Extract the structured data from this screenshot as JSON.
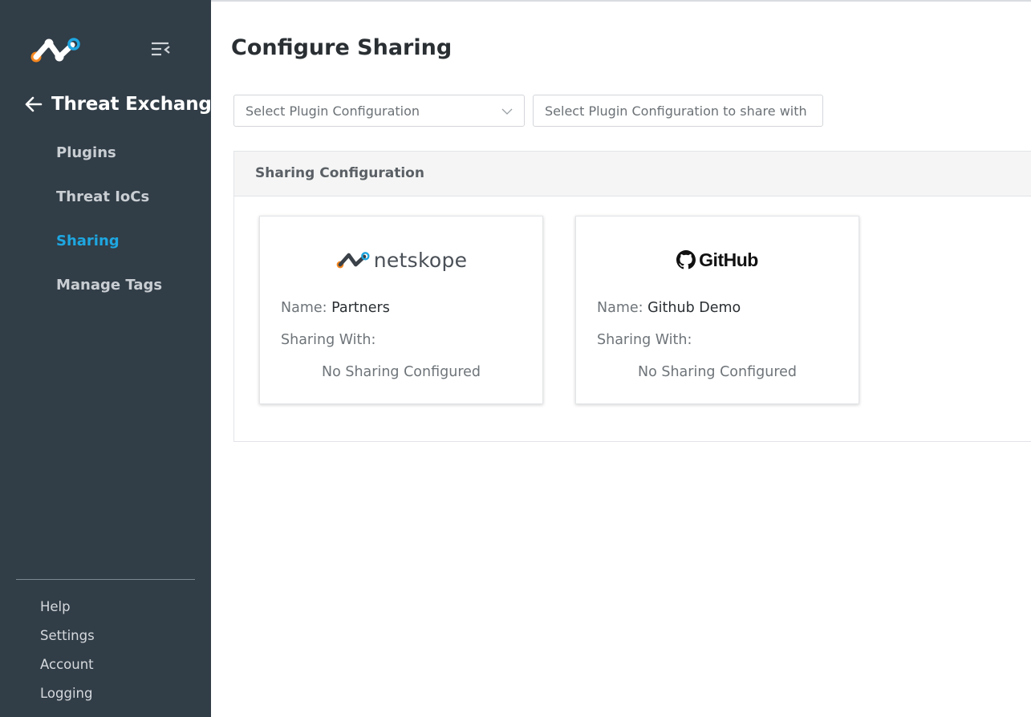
{
  "sidebar": {
    "section_title": "Threat Exchange",
    "nav": [
      {
        "label": "Plugins",
        "active": false
      },
      {
        "label": "Threat IoCs",
        "active": false
      },
      {
        "label": "Sharing",
        "active": true
      },
      {
        "label": "Manage Tags",
        "active": false
      }
    ],
    "footer": [
      "Help",
      "Settings",
      "Account",
      "Logging"
    ]
  },
  "main": {
    "title": "Configure Sharing",
    "selects": [
      {
        "placeholder": "Select Plugin Configuration",
        "has_dropdown_icon": true
      },
      {
        "placeholder": "Select Plugin Configuration to share with",
        "has_dropdown_icon": false
      }
    ],
    "panel": {
      "title": "Sharing Configuration",
      "cards": [
        {
          "logo": "netskope-logo",
          "logo_text": "netskope",
          "name_label": "Name:",
          "name": "Partners",
          "sharing_label": "Sharing With:",
          "sharing_value": "No Sharing Configured"
        },
        {
          "logo": "github-logo",
          "logo_text": "GitHub",
          "name_label": "Name:",
          "name": "Github Demo",
          "sharing_label": "Sharing With:",
          "sharing_value": "No Sharing Configured"
        }
      ]
    }
  },
  "colors": {
    "sidebar_bg": "#313d47",
    "active_nav": "#1ea7e1",
    "logo_orange": "#f5871f",
    "logo_blue": "#1ea7e1"
  },
  "icons": [
    "netskope-logo-icon",
    "collapse-menu-icon",
    "back-arrow-icon",
    "chevron-down-icon",
    "github-octocat-icon"
  ]
}
